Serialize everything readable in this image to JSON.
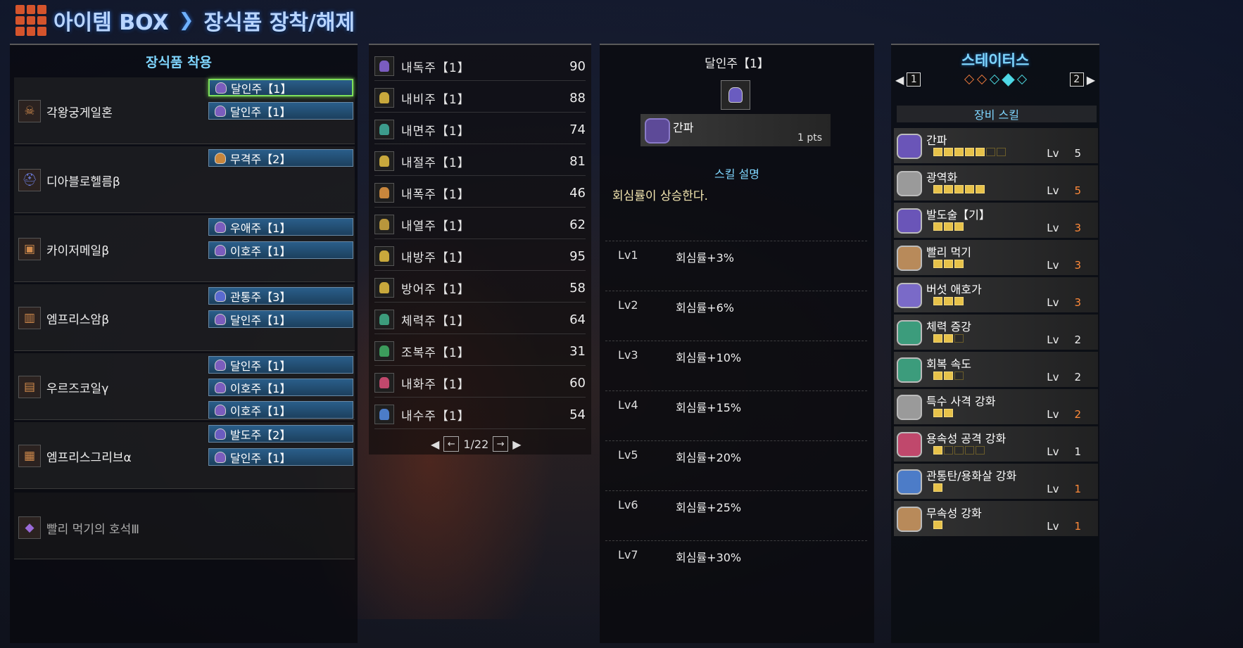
{
  "header": {
    "menu": "아이템 BOX",
    "separator": "❯",
    "screen": "장식품 장착/해제"
  },
  "left": {
    "title": "장식품 착용",
    "armor": [
      {
        "name": "각왕궁게일혼",
        "icon": "helm-icon",
        "slots": [
          "달인주【1】",
          "달인주【1】"
        ]
      },
      {
        "name": "디아블로헬름β",
        "icon": "helm-icon",
        "slots": [
          "무격주【2】"
        ]
      },
      {
        "name": "카이저메일β",
        "icon": "chest-icon",
        "slots": [
          "우애주【1】",
          "이호주【1】"
        ]
      },
      {
        "name": "엠프리스암β",
        "icon": "arm-icon",
        "slots": [
          "관통주【3】",
          "달인주【1】"
        ]
      },
      {
        "name": "우르즈코일γ",
        "icon": "waist-icon",
        "slots": [
          "달인주【1】",
          "이호주【1】",
          "이호주【1】"
        ]
      },
      {
        "name": "엠프리스그리브α",
        "icon": "leg-icon",
        "slots": [
          "발도주【2】",
          "달인주【1】"
        ]
      },
      {
        "name": "빨리 먹기의 호석Ⅲ",
        "icon": "charm-icon",
        "slots": []
      }
    ]
  },
  "list": {
    "items": [
      {
        "name": "내독주【1】",
        "count": "90",
        "color": "#7a5cc0"
      },
      {
        "name": "내비주【1】",
        "count": "88",
        "color": "#c8a83c"
      },
      {
        "name": "내면주【1】",
        "count": "74",
        "color": "#3c9c8c"
      },
      {
        "name": "내절주【1】",
        "count": "81",
        "color": "#c8a83c"
      },
      {
        "name": "내폭주【1】",
        "count": "46",
        "color": "#c8863c"
      },
      {
        "name": "내열주【1】",
        "count": "62",
        "color": "#b8963c"
      },
      {
        "name": "내방주【1】",
        "count": "95",
        "color": "#c8a83c"
      },
      {
        "name": "방어주【1】",
        "count": "58",
        "color": "#c8a83c"
      },
      {
        "name": "체력주【1】",
        "count": "64",
        "color": "#3c9c7c"
      },
      {
        "name": "조복주【1】",
        "count": "31",
        "color": "#3c9c5c"
      },
      {
        "name": "내화주【1】",
        "count": "60",
        "color": "#c0486c"
      },
      {
        "name": "내수주【1】",
        "count": "54",
        "color": "#4c7cc8"
      }
    ],
    "page": "1/22",
    "prev": "←",
    "next": "→",
    "arrow_left": "◀",
    "arrow_right": "▶"
  },
  "detail": {
    "title": "달인주【1】",
    "skill_name": "간파",
    "skill_points": "1 pts",
    "section_title": "스킬 설명",
    "description": "회심률이 상승한다.",
    "levels": [
      {
        "lv": "Lv1",
        "effect": "회심률+3%"
      },
      {
        "lv": "Lv2",
        "effect": "회심률+6%"
      },
      {
        "lv": "Lv3",
        "effect": "회심률+10%"
      },
      {
        "lv": "Lv4",
        "effect": "회심률+15%"
      },
      {
        "lv": "Lv5",
        "effect": "회심률+20%"
      },
      {
        "lv": "Lv6",
        "effect": "회심률+25%"
      },
      {
        "lv": "Lv7",
        "effect": "회심률+30%"
      }
    ]
  },
  "status": {
    "title": "스테이터스",
    "page_left": "1",
    "page_right": "2",
    "equip_title": "장비 스킬",
    "lv_label": "Lv",
    "skills": [
      {
        "name": "간파",
        "level": "5",
        "max_reached": false,
        "filled": 5,
        "total": 7,
        "color": "#6a55b8"
      },
      {
        "name": "광역화",
        "level": "5",
        "max_reached": true,
        "filled": 5,
        "total": 5,
        "color": "#9a9a9a"
      },
      {
        "name": "발도술【기】",
        "level": "3",
        "max_reached": true,
        "filled": 3,
        "total": 3,
        "color": "#6a55b8"
      },
      {
        "name": "빨리 먹기",
        "level": "3",
        "max_reached": true,
        "filled": 3,
        "total": 3,
        "color": "#b88a5a"
      },
      {
        "name": "버섯 애호가",
        "level": "3",
        "max_reached": true,
        "filled": 3,
        "total": 3,
        "color": "#7a6ac8"
      },
      {
        "name": "체력 증강",
        "level": "2",
        "max_reached": false,
        "filled": 2,
        "total": 3,
        "color": "#3c9c7c"
      },
      {
        "name": "회복 속도",
        "level": "2",
        "max_reached": false,
        "filled": 2,
        "total": 3,
        "color": "#3c9c7c"
      },
      {
        "name": "특수 사격 강화",
        "level": "2",
        "max_reached": true,
        "filled": 2,
        "total": 2,
        "color": "#9a9a9a"
      },
      {
        "name": "용속성 공격 강화",
        "level": "1",
        "max_reached": false,
        "filled": 1,
        "total": 5,
        "color": "#c0486c"
      },
      {
        "name": "관통탄/용화살 강화",
        "level": "1",
        "max_reached": true,
        "filled": 1,
        "total": 1,
        "color": "#4c7cc8"
      },
      {
        "name": "무속성 강화",
        "level": "1",
        "max_reached": true,
        "filled": 1,
        "total": 1,
        "color": "#b88a5a"
      }
    ]
  }
}
